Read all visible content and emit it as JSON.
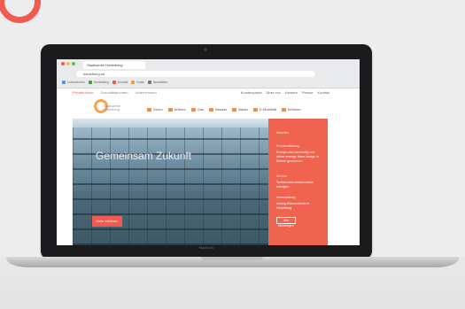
{
  "browser": {
    "tab_title": "Stadtwerke Heidelberg",
    "url": "heidelberg.de",
    "bookmarks": [
      {
        "label": "Lesezeichen",
        "color": "#5b8def"
      },
      {
        "label": "Heidelberg",
        "color": "#4a9a4a"
      },
      {
        "label": "Kontakt",
        "color": "#e55"
      },
      {
        "label": "Karte",
        "color": "#f0a030"
      },
      {
        "label": "Newsletter",
        "color": "#777"
      }
    ]
  },
  "site": {
    "topnav_left": [
      "Privatkunden",
      "Geschäftskunden",
      "Unternehmen"
    ],
    "topnav_right": [
      "Kundenportal",
      "Über uns",
      "Karriere",
      "Presse",
      "Kontakt"
    ],
    "logo_text": "Stadtwerke Heidelberg",
    "mainnav": [
      "Strom",
      "Wärme",
      "Gas",
      "Wasser",
      "Bäder",
      "E-Mobilität",
      "Wohnen"
    ],
    "hero_title": "Gemeinsam Zukunft",
    "hero_button": "Mehr erfahren",
    "panel": {
      "heading": "Aktuelles",
      "items": [
        {
          "label": "Pressemitteilung",
          "text": "Energie wird nachhaltig und sicher erzeugt: Neue Anlage in Betrieb genommen"
        },
        {
          "label": "Service",
          "text": "Tarifwechsel einfach online erledigen"
        },
        {
          "label": "Veranstaltung",
          "text": "Infotag Wärmewende in Heidelberg"
        }
      ],
      "button": "Alle Meldungen"
    }
  },
  "laptop_brand": "MacBook",
  "colors": {
    "accent": "#f05a4f",
    "logo": "#f2a54a",
    "background": "#ededed"
  }
}
